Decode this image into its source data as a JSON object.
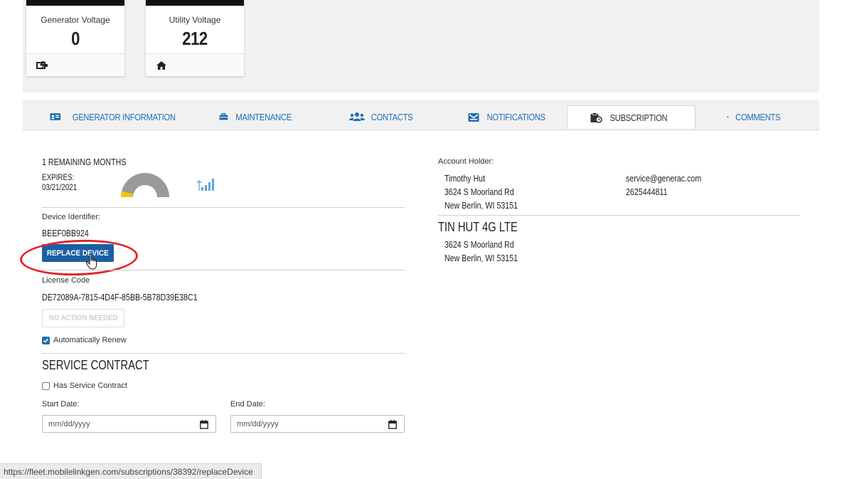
{
  "cards": [
    {
      "label": "Generator Voltage",
      "value": "0",
      "icon": "generator-power-icon"
    },
    {
      "label": "Utility Voltage",
      "value": "212",
      "icon": "home-icon"
    }
  ],
  "tabs": [
    {
      "label": "GENERATOR INFORMATION",
      "icon": "id-card-icon"
    },
    {
      "label": "MAINTENANCE",
      "icon": "toolbox-icon"
    },
    {
      "label": "CONTACTS",
      "icon": "users-icon"
    },
    {
      "label": "NOTIFICATIONS",
      "icon": "envelope-icon"
    },
    {
      "label": "SUBSCRIPTION",
      "icon": "subscription-icon",
      "active": true
    },
    {
      "label": "COMMENTS",
      "icon": "comments-icon"
    }
  ],
  "subscription": {
    "remaining": "1 REMAINING MONTHS",
    "expires_label": "EXPIRES:",
    "expires_date": "03/21/2021",
    "remaining_fraction": 0.08,
    "device_identifier_label": "Device Identifier:",
    "device_identifier_value": "BEEF0BB924",
    "replace_button": "REPLACE DEVICE",
    "license_code_label": "License Code",
    "license_code_value": "DE72089A-7815-4D4F-85BB-5B78D39E38C1",
    "no_action_button": "NO ACTION NEEDED",
    "auto_renew_label": "Automatically Renew",
    "auto_renew_checked": true
  },
  "service_contract": {
    "title": "SERVICE CONTRACT",
    "has_contract_label": "Has Service Contract",
    "has_contract_checked": false,
    "start_label": "Start Date:",
    "end_label": "End Date:",
    "start_placeholder": "mm/dd/yyyy",
    "end_placeholder": "mm/dd/yyyy"
  },
  "account": {
    "label": "Account Holder:",
    "name": "Timothy Hut",
    "address1": "3624 S Moorland Rd",
    "address2": "New Berlin, WI 53151",
    "email": "service@generac.com",
    "phone": "2625444811"
  },
  "site": {
    "name": "TIN HUT 4G LTE",
    "address1": "3624 S Moorland Rd",
    "address2": "New Berlin, WI 53151"
  },
  "status_url": "https://fleet.mobilelinkgen.com/subscriptions/38392/replaceDevice",
  "colors": {
    "accent": "#1f6db5",
    "button": "#1b5fa3",
    "gauge_fill": "#f5c400",
    "gauge_track": "#9a9a9a",
    "highlight": "#e3242b"
  }
}
